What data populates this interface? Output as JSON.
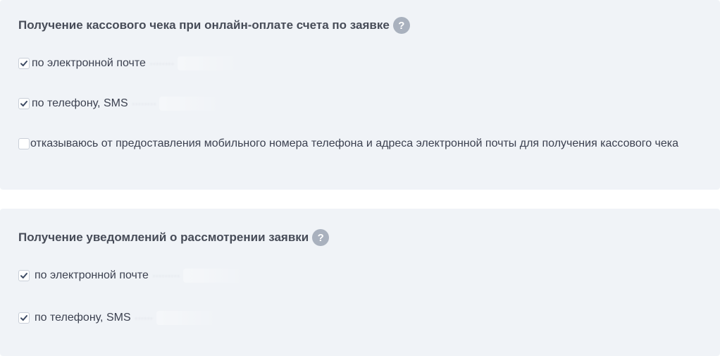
{
  "receipt_section": {
    "title": "Получение кассового чека при онлайн-оплате счета по заявке",
    "help_icon": "?",
    "options": [
      {
        "label": "по электронной почте",
        "masked_value": "∙∙∙∙∙∙∙∙",
        "checked": true
      },
      {
        "label": "по телефону, SMS",
        "masked_value": "∙∙∙∙∙∙∙∙",
        "checked": true
      },
      {
        "label": "отказываюсь от предоставления мобильного номера телефона и адреса электронной почты для получения кассового чека",
        "checked": false
      }
    ]
  },
  "notification_section": {
    "title": "Получение уведомлений о рассмотрении заявки",
    "help_icon": "?",
    "options": [
      {
        "label": "по электронной почте",
        "masked_value": "∙∙∙∙∙∙∙∙∙",
        "checked": true
      },
      {
        "label": "по телефону, SMS",
        "masked_value": "∙∙∙∙∙∙",
        "checked": true
      }
    ]
  },
  "colors": {
    "panel_bg": "#f0f3f7",
    "help_badge": "#a9b1be",
    "checkmark": "#3c4a63",
    "text": "#3c4150"
  }
}
